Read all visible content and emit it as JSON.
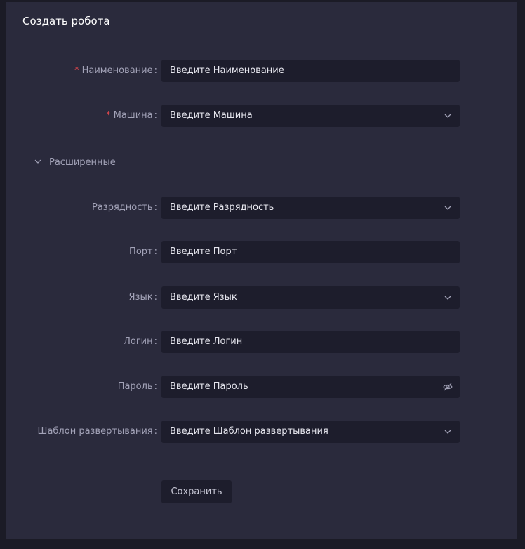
{
  "title": "Создать робота",
  "required_marker": "*",
  "colon": ":",
  "fields": [
    {
      "label": "Наименование",
      "placeholder": "Введите Наименование",
      "required": true,
      "control": "text"
    },
    {
      "label": "Машина",
      "placeholder": "Введите Машина",
      "required": true,
      "control": "select"
    }
  ],
  "advanced": {
    "label": "Расширенные",
    "expanded": true,
    "fields": [
      {
        "label": "Разрядность",
        "placeholder": "Введите Разрядность",
        "control": "select"
      },
      {
        "label": "Порт",
        "placeholder": "Введите Порт",
        "control": "text"
      },
      {
        "label": "Язык",
        "placeholder": "Введите Язык",
        "control": "select"
      },
      {
        "label": "Логин",
        "placeholder": "Введите Логин",
        "control": "text"
      },
      {
        "label": "Пароль",
        "placeholder": "Введите Пароль",
        "control": "password"
      },
      {
        "label": "Шаблон развертывания",
        "placeholder": "Введите Шаблон развертывания",
        "control": "select"
      }
    ]
  },
  "save_label": "Сохранить",
  "colors": {
    "page_bg": "#1b1b26",
    "panel_bg": "#2a2a3c",
    "input_bg": "#1d1d2c",
    "label": "#a3a3b8",
    "required": "#e5484d",
    "text": "#e6e6ee"
  }
}
